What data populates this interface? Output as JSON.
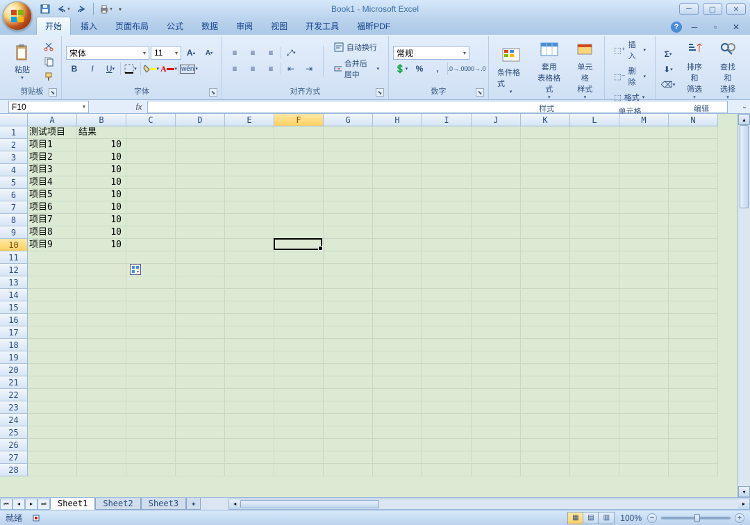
{
  "title": "Book1 - Microsoft Excel",
  "qat": {
    "save": "💾",
    "undo": "↶",
    "redo": "↷",
    "print": "🖨"
  },
  "tabs": [
    "开始",
    "插入",
    "页面布局",
    "公式",
    "数据",
    "审阅",
    "视图",
    "开发工具",
    "福昕PDF"
  ],
  "activeTab": 0,
  "ribbon": {
    "clipboard": {
      "title": "剪贴板",
      "paste": "粘贴"
    },
    "font": {
      "title": "字体",
      "name": "宋体",
      "size": "11"
    },
    "align": {
      "title": "对齐方式",
      "wrap": "自动换行",
      "merge": "合并后居中"
    },
    "number": {
      "title": "数字",
      "format": "常规"
    },
    "styles": {
      "title": "样式",
      "cond": "条件格式",
      "table": "套用\n表格格式",
      "cell": "单元格\n样式"
    },
    "cells": {
      "title": "单元格",
      "insert": "插入",
      "delete": "删除",
      "format": "格式"
    },
    "editing": {
      "title": "编辑",
      "sort": "排序和\n筛选",
      "find": "查找和\n选择"
    }
  },
  "nameBox": "F10",
  "columns": [
    "A",
    "B",
    "C",
    "D",
    "E",
    "F",
    "G",
    "H",
    "I",
    "J",
    "K",
    "L",
    "M",
    "N"
  ],
  "activeCol": "F",
  "activeRow": 10,
  "rows": 28,
  "cells": {
    "A1": "测试项目",
    "B1": "结果",
    "A2": "项目1",
    "B2": "10",
    "A3": "项目2",
    "B3": "10",
    "A4": "项目3",
    "B4": "10",
    "A5": "项目4",
    "B5": "10",
    "A6": "项目5",
    "B6": "10",
    "A7": "项目6",
    "B7": "10",
    "A8": "项目7",
    "B8": "10",
    "A9": "项目8",
    "B9": "10",
    "A10": "项目9",
    "B10": "10"
  },
  "sheets": [
    "Sheet1",
    "Sheet2",
    "Sheet3"
  ],
  "activeSheet": 0,
  "status": "就绪",
  "zoom": "100%"
}
